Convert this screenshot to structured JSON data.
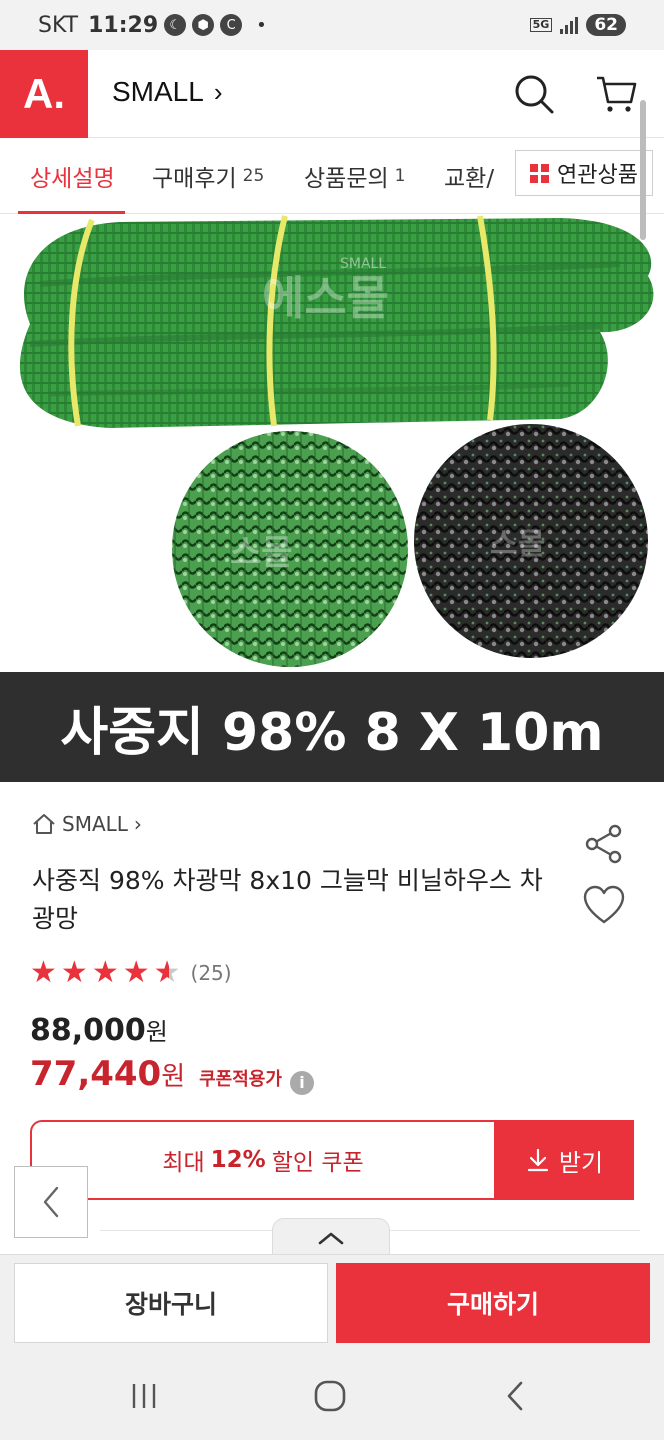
{
  "status_bar": {
    "carrier": "SKT",
    "time": "11:29",
    "network": "5G",
    "battery": "62"
  },
  "header": {
    "logo_text": "A.",
    "store_name": "SMALL",
    "store_chevron": "›",
    "search_icon": "search-icon",
    "cart_icon": "cart-icon"
  },
  "tabs": [
    {
      "label": "상세설명",
      "count": "",
      "active": true
    },
    {
      "label": "구매후기",
      "count": "25",
      "active": false
    },
    {
      "label": "상품문의",
      "count": "1",
      "active": false
    },
    {
      "label": "교환/",
      "count": "",
      "active": false
    }
  ],
  "related_button": {
    "label": "연관상품"
  },
  "product_image": {
    "watermark": "SMALL",
    "watermark_korean": "에스몰",
    "colors": {
      "green": "#2f9a3c",
      "dark": "#222222",
      "tie": "#e8e86a"
    }
  },
  "banner": {
    "text": "사중지 98% 8 X 10m"
  },
  "brand": {
    "label": "SMALL",
    "chevron": "›"
  },
  "product": {
    "title": "사중직 98% 차광막 8x10 그늘막 비닐하우스 차광망",
    "rating": 4.5,
    "review_count": "(25)",
    "original_price": "88,000",
    "original_unit": "원",
    "sale_price": "77,440",
    "sale_unit": "원",
    "coupon_note": "쿠폰적용가",
    "info_icon": "i"
  },
  "coupon": {
    "prefix": "최대",
    "percent": "12%",
    "suffix": "할인 쿠폰",
    "download_label": "받기",
    "download_icon": "↓"
  },
  "floating": {
    "back_label": "‹",
    "handle_label": "⌃"
  },
  "bottom_bar": {
    "cart_label": "장바구니",
    "buy_label": "구매하기"
  },
  "colors": {
    "accent": "#e9323c",
    "price_red": "#c8242d",
    "banner_bg": "#2f2f2f"
  }
}
